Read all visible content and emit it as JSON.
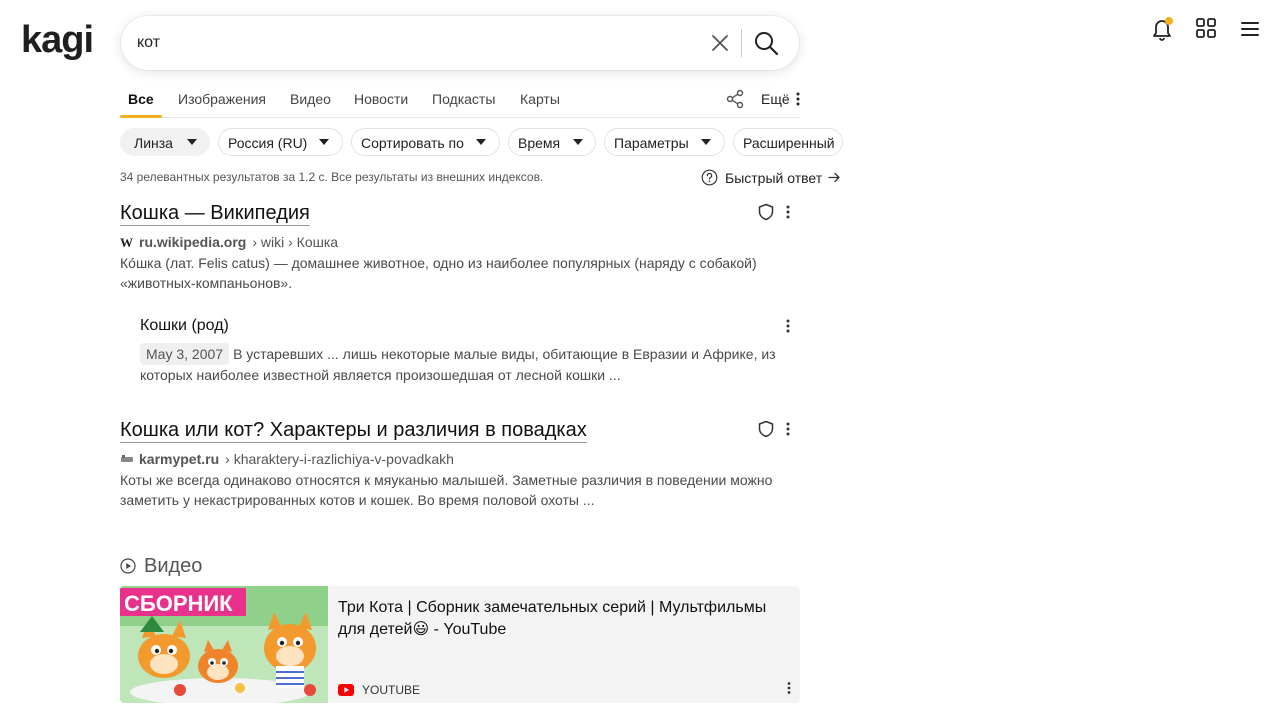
{
  "brand": {
    "logo_text": "kagi",
    "accent_color": "#f2b01e"
  },
  "search": {
    "query": "кот",
    "placeholder": ""
  },
  "header": {
    "notifications_icon": "bell-icon",
    "apps_icon": "grid-icon",
    "menu_icon": "hamburger-icon"
  },
  "tabs": [
    {
      "label": "Все",
      "active": true
    },
    {
      "label": "Изображения"
    },
    {
      "label": "Видео"
    },
    {
      "label": "Новости"
    },
    {
      "label": "Подкасты"
    },
    {
      "label": "Карты"
    }
  ],
  "more_label": "Ещё",
  "filters": {
    "lens": "Линза",
    "region": "Россия (RU)",
    "sort": "Сортировать по",
    "time": "Время",
    "params": "Параметры",
    "advanced": "Расширенный"
  },
  "stats_text": "34 релевантных результатов за 1.2 с. Все результаты из внешних индексов.",
  "quick_answer_label": "Быстрый ответ",
  "results": [
    {
      "title": "Кошка — Википедия",
      "domain": "ru.wikipedia.org",
      "path": "› wiki › Кошка",
      "snippet": "Ко́шка (лат. Felis catus) — домашнее животное, одно из наиболее популярных (наряду с собакой) «животных-компаньонов»."
    },
    {
      "title": "Кошка или кот? Характеры и различия в повадках",
      "domain": "karmypet.ru",
      "path": "› kharaktery-i-razlichiya-v-povadkakh",
      "snippet": "Коты же всегда одинаково относятся к мяуканью малышей. Заметные различия в поведении можно заметить у некастрированных котов и кошек. Во время половой охоты ..."
    }
  ],
  "sub_result": {
    "title": "Кошки (род)",
    "date": "May 3, 2007",
    "snippet": "В устаревших ... лишь некоторые малые виды, обитающие в Евразии и Африке, из которых наиболее известной является произошедшая от лесной кошки ..."
  },
  "video_section": {
    "heading": "Видео",
    "items": [
      {
        "thumb_text": "СБОРНИК",
        "title": "Три Кота | Сборник замечательных серий | Мультфильмы для детей😃 - YouTube",
        "source": "YOUTUBE"
      }
    ]
  }
}
